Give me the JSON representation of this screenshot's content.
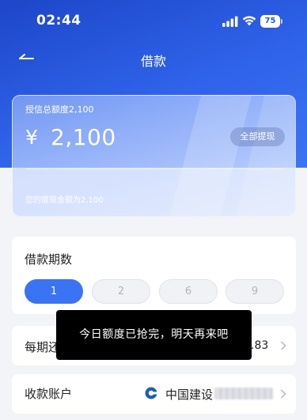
{
  "status_bar": {
    "time": "02:44",
    "battery": "75"
  },
  "nav": {
    "title": "借款",
    "back_icon": "back-arrow-icon"
  },
  "credit_card": {
    "total_label": "授信总额度2,100",
    "currency": "¥",
    "amount": "2,100",
    "withdraw_all_label": "全部提现",
    "withdraw_hint": "您的提现金额为2,100"
  },
  "loan_term": {
    "title": "借款期数",
    "options": [
      "1",
      "2",
      "6",
      "9"
    ],
    "selected": "1"
  },
  "repayment": {
    "label_visible": "每期还",
    "amount_visible": ".83"
  },
  "account": {
    "label": "收款账户",
    "bank_icon": "bank-logo-icon",
    "bank_name_visible": "中国建设"
  },
  "toast": {
    "message": "今日额度已抢完，明天再来吧"
  },
  "colors": {
    "header_blue": "#2f63ea",
    "accent_blue": "#3a73f3",
    "page_bg": "#f3f4f8",
    "toast_bg": "#000000"
  }
}
